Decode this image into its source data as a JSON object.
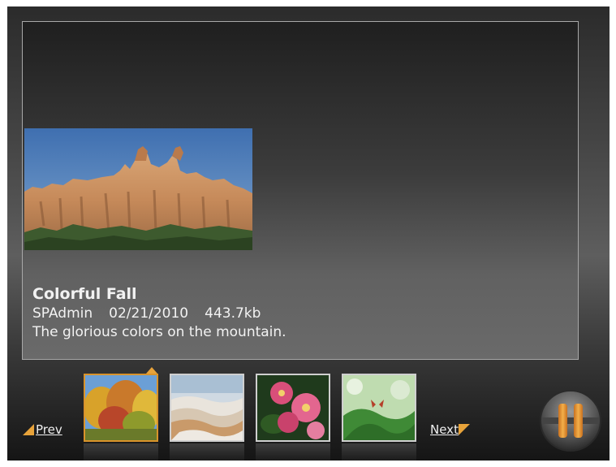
{
  "photo": {
    "title": "Colorful Fall",
    "author": "SPAdmin",
    "date": "02/21/2010",
    "size": "443.7kb",
    "description": "The glorious colors on the mountain."
  },
  "nav": {
    "prev_label": "Prev",
    "next_label": "Next"
  },
  "thumbnails": [
    {
      "icon": "autumn-trees-thumbnail",
      "selected": true
    },
    {
      "icon": "travertine-terraces-thumbnail",
      "selected": false
    },
    {
      "icon": "pink-flowers-thumbnail",
      "selected": false
    },
    {
      "icon": "butterfly-leaves-thumbnail",
      "selected": false
    }
  ],
  "controls": {
    "play_state_icon": "pause-icon"
  },
  "colors": {
    "accent": "#e8a33a",
    "frame_border": "#a8a8a8",
    "caption_text": "#f2f2f2"
  }
}
